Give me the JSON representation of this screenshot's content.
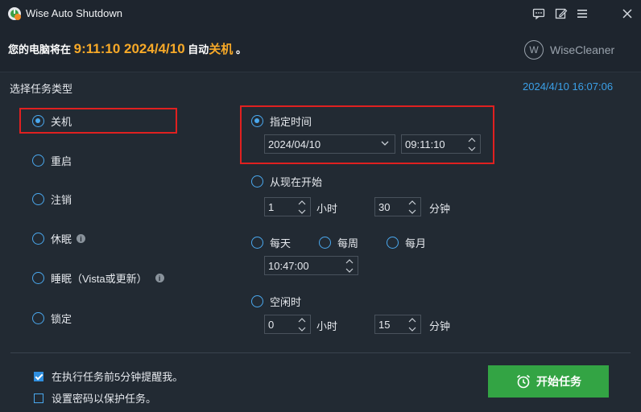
{
  "window": {
    "title": "Wise Auto Shutdown"
  },
  "titlebar": {
    "icons": [
      "feedback-icon",
      "edit-icon",
      "menu-icon",
      "close-icon"
    ]
  },
  "banner": {
    "prefix": "您的电脑将在",
    "time": "9:11:10 2024/4/10",
    "mid": "自动",
    "action": "关机",
    "suffix": "。",
    "brand": "WiseCleaner"
  },
  "task": {
    "section_label": "选择任务类型",
    "current_datetime": "2024/4/10 16:07:06",
    "types": [
      {
        "label": "关机",
        "selected": true
      },
      {
        "label": "重启",
        "selected": false
      },
      {
        "label": "注销",
        "selected": false
      },
      {
        "label": "休眠",
        "selected": false
      },
      {
        "label": "睡眠（Vista或更新）",
        "selected": false
      },
      {
        "label": "锁定",
        "selected": false
      }
    ]
  },
  "schedule": {
    "specific": {
      "label": "指定时间",
      "selected": true,
      "date": "2024/04/10",
      "time": "09:11:10"
    },
    "from_now": {
      "label": "从现在开始",
      "selected": false,
      "hours": "1",
      "hours_unit": "小时",
      "minutes": "30",
      "minutes_unit": "分钟"
    },
    "daily": {
      "label": "每天",
      "selected": false
    },
    "weekly": {
      "label": "每周",
      "selected": false
    },
    "monthly": {
      "label": "每月",
      "selected": false
    },
    "recurring_time": "10:47:00",
    "idle": {
      "label": "空闲时",
      "selected": false,
      "hours": "0",
      "hours_unit": "小时",
      "minutes": "15",
      "minutes_unit": "分钟"
    }
  },
  "footer": {
    "remind": {
      "label": "在执行任务前5分钟提醒我。",
      "checked": true
    },
    "password": {
      "label": "设置密码以保护任务。",
      "checked": false
    },
    "start_button": "开始任务"
  },
  "colors": {
    "accent": "#4aa8ee",
    "highlight": "#e02020",
    "start": "#33a444",
    "banner_time": "#f7a928"
  }
}
